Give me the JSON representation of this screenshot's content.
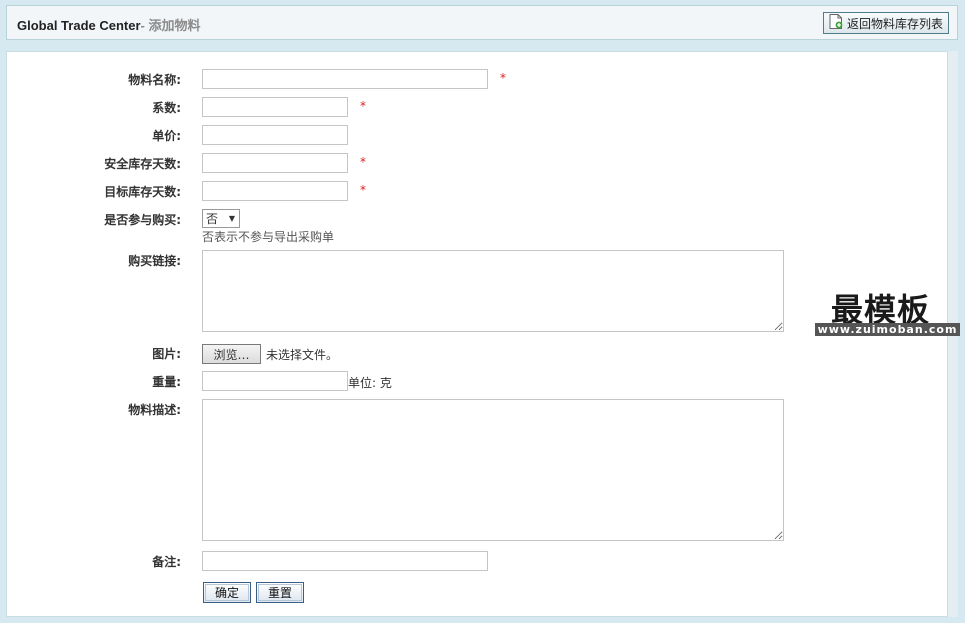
{
  "header": {
    "app_name": "Global Trade Center",
    "page_title": "- 添加物料",
    "back_button_label": "返回物料库存列表"
  },
  "form": {
    "material_name": {
      "label": "物料名称:",
      "value": "",
      "required_mark": "*"
    },
    "coefficient": {
      "label": "系数:",
      "value": "",
      "required_mark": "*"
    },
    "unit_price": {
      "label": "单价:",
      "value": ""
    },
    "safety_stock_days": {
      "label": "安全库存天数:",
      "value": "",
      "required_mark": "*"
    },
    "target_stock_days": {
      "label": "目标库存天数:",
      "value": "",
      "required_mark": "*"
    },
    "join_purchase": {
      "label": "是否参与购买:",
      "selected": "否",
      "hint": "否表示不参与导出采购单"
    },
    "purchase_link": {
      "label": "购买链接:",
      "value": ""
    },
    "image": {
      "label": "图片:",
      "browse_label": "浏览…",
      "file_status": "未选择文件。"
    },
    "weight": {
      "label": "重量:",
      "value": "",
      "unit_hint": "单位: 克"
    },
    "description": {
      "label": "物料描述:",
      "value": ""
    },
    "remark": {
      "label": "备注:",
      "value": ""
    },
    "submit_label": "确定",
    "reset_label": "重置"
  },
  "watermark": {
    "main_text": "最模板",
    "url_text": "www.zuimoban.com"
  },
  "colors": {
    "background": "#d6e9f0",
    "required": "#e02020",
    "header_bg": "#f2f6f8"
  }
}
